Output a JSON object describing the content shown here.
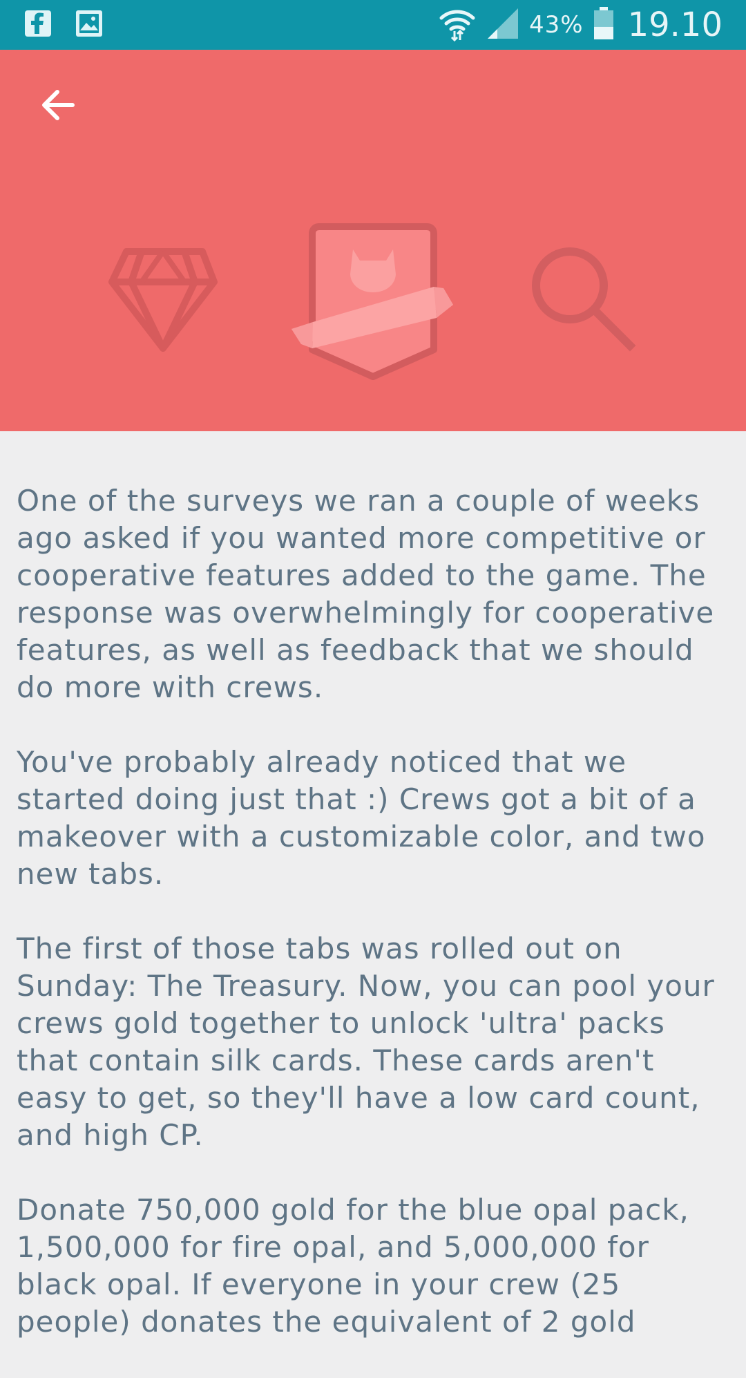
{
  "status_bar": {
    "left_icons": [
      "facebook-icon",
      "gallery-icon"
    ],
    "right_icons": [
      "wifi-icon",
      "signal-icon",
      "battery-icon"
    ],
    "battery_percent": "43%",
    "battery_level": 0.43,
    "time": "19.10"
  },
  "header": {
    "back_icon": "arrow-left-icon",
    "background_color": "#ef6a6a",
    "illustrations": [
      "diamond-icon",
      "shield-badge-icon",
      "magnifier-icon"
    ]
  },
  "article": {
    "paragraphs": [
      "One of the surveys we ran a couple of weeks ago asked if you wanted more competitive or cooperative features added to the game. The response was overwhelmingly for cooperative features, as well as feedback that we should do more with crews.",
      "You've probably already noticed that we started doing just that :) Crews got a bit of a makeover with a customizable color, and two new tabs.",
      "The first of those tabs was rolled out on Sunday: The Treasury. Now, you can pool your crews gold together to unlock 'ultra' packs that contain silk cards. These cards aren't easy to get, so they'll have a low card count, and high CP.",
      "Donate 750,000 gold for the blue opal pack, 1,500,000 for fire opal, and 5,000,000 for black opal. If everyone in your crew (25 people) donates the equivalent of 2 gold"
    ]
  },
  "colors": {
    "status_bar": "#0f95a8",
    "header": "#ef6a6a",
    "body_text": "#5e7485",
    "page_background": "#eeeeef"
  }
}
